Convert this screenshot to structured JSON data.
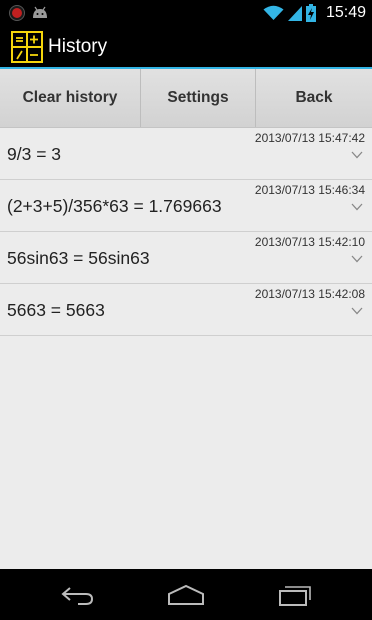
{
  "status_bar": {
    "time": "15:49",
    "icons": [
      "record-icon",
      "android-debug-icon",
      "wifi-icon",
      "signal-icon",
      "battery-charging-icon"
    ]
  },
  "action_bar": {
    "title": "History",
    "icon": "calculator-icon"
  },
  "toolbar": {
    "clear_label": "Clear history",
    "settings_label": "Settings",
    "back_label": "Back"
  },
  "history": [
    {
      "timestamp": "2013/07/13 15:47:42",
      "expression": "9/3 = 3"
    },
    {
      "timestamp": "2013/07/13 15:46:34",
      "expression": "(2+3+5)/356*63 = 1.769663"
    },
    {
      "timestamp": "2013/07/13 15:42:10",
      "expression": "56sin63 = 56sin63"
    },
    {
      "timestamp": "2013/07/13 15:42:08",
      "expression": "5663 = 5663"
    }
  ],
  "nav_bar": {
    "icons": [
      "back-icon",
      "home-icon",
      "recent-apps-icon"
    ]
  },
  "colors": {
    "accent": "#33b5e5",
    "app_icon": "#f5d60c",
    "content_bg": "#ececec"
  }
}
